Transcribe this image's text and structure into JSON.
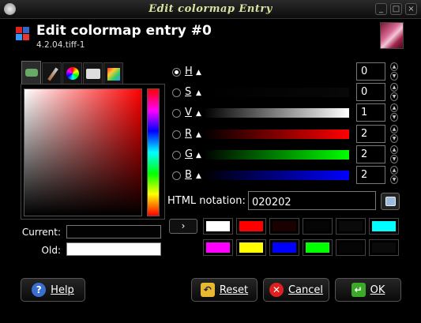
{
  "window": {
    "title": "Edit colormap Entry"
  },
  "header": {
    "title": "Edit colormap entry #0",
    "subtitle": "4.2.04.tiff-1"
  },
  "swatches": {
    "current_label": "Current:",
    "old_label": "Old:",
    "current_color": "#020202",
    "old_color": "#ffffff"
  },
  "channels": [
    {
      "key": "H",
      "value": "0",
      "selected": true,
      "gradient": "linear-gradient(to right,#000,#000)"
    },
    {
      "key": "S",
      "value": "0",
      "selected": false,
      "gradient": "linear-gradient(to right,#000,#080808)"
    },
    {
      "key": "V",
      "value": "1",
      "selected": false,
      "gradient": "linear-gradient(to right,#000,#fff)"
    },
    {
      "key": "R",
      "value": "2",
      "selected": false,
      "gradient": "linear-gradient(to right,#000,#f00)"
    },
    {
      "key": "G",
      "value": "2",
      "selected": false,
      "gradient": "linear-gradient(to right,#000,#0f0)"
    },
    {
      "key": "B",
      "value": "2",
      "selected": false,
      "gradient": "linear-gradient(to right,#000,#00f)"
    }
  ],
  "html_notation": {
    "label": "HTML notation:",
    "value": "020202"
  },
  "history": {
    "arrow": "›",
    "colors": [
      "#ffffff",
      "#ff0000",
      "#1a0000",
      "#050505",
      "#0a0a0a",
      "#00ffff",
      "#ff00ff",
      "#ffff00",
      "#0000ff",
      "#00ff00",
      "#050505",
      "#0a0a0a"
    ]
  },
  "buttons": {
    "help": "Help",
    "reset": "Reset",
    "cancel": "Cancel",
    "ok": "OK"
  }
}
